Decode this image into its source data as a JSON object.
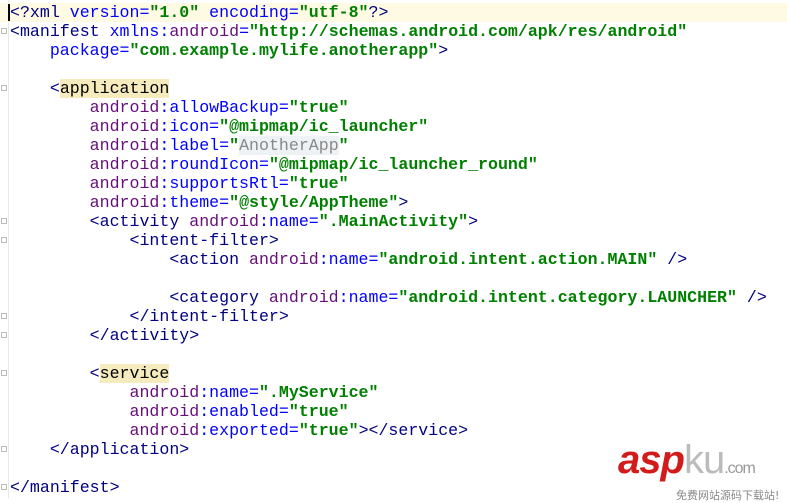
{
  "editor": {
    "current_line": 0,
    "lines": [
      [
        [
          "p",
          "<?xml "
        ],
        [
          "a",
          "version="
        ],
        [
          "v",
          "\"1.0\""
        ],
        [
          "a",
          " encoding="
        ],
        [
          "v",
          "\"utf-8\""
        ],
        [
          "p",
          "?>"
        ]
      ],
      [
        [
          "p",
          "<manifest "
        ],
        [
          "a",
          "xmlns:"
        ],
        [
          "n",
          "android"
        ],
        [
          "a",
          "="
        ],
        [
          "v",
          "\"http://schemas.android.com/apk/res/android\""
        ]
      ],
      [
        [
          "s",
          "    "
        ],
        [
          "a",
          "package="
        ],
        [
          "v",
          "\"com.example.mylife.anotherapp\""
        ],
        [
          "p",
          ">"
        ]
      ],
      [],
      [
        [
          "s",
          "    "
        ],
        [
          "p",
          "<"
        ],
        [
          "hl",
          "application"
        ]
      ],
      [
        [
          "s",
          "        "
        ],
        [
          "n",
          "android"
        ],
        [
          "a",
          ":allowBackup="
        ],
        [
          "v",
          "\"true\""
        ]
      ],
      [
        [
          "s",
          "        "
        ],
        [
          "n",
          "android"
        ],
        [
          "a",
          ":icon="
        ],
        [
          "v",
          "\"@mipmap/ic_launcher\""
        ]
      ],
      [
        [
          "s",
          "        "
        ],
        [
          "n",
          "android"
        ],
        [
          "a",
          ":label="
        ],
        [
          "v",
          "\""
        ],
        [
          "g",
          "AnotherApp"
        ],
        [
          "v",
          "\""
        ]
      ],
      [
        [
          "s",
          "        "
        ],
        [
          "n",
          "android"
        ],
        [
          "a",
          ":roundIcon="
        ],
        [
          "v",
          "\"@mipmap/ic_launcher_round\""
        ]
      ],
      [
        [
          "s",
          "        "
        ],
        [
          "n",
          "android"
        ],
        [
          "a",
          ":supportsRtl="
        ],
        [
          "v",
          "\"true\""
        ]
      ],
      [
        [
          "s",
          "        "
        ],
        [
          "n",
          "android"
        ],
        [
          "a",
          ":theme="
        ],
        [
          "v",
          "\"@style/AppTheme\""
        ],
        [
          "p",
          ">"
        ]
      ],
      [
        [
          "s",
          "        "
        ],
        [
          "p",
          "<activity "
        ],
        [
          "n",
          "android"
        ],
        [
          "a",
          ":name="
        ],
        [
          "v",
          "\".MainActivity\""
        ],
        [
          "p",
          ">"
        ]
      ],
      [
        [
          "s",
          "            "
        ],
        [
          "p",
          "<intent-filter>"
        ]
      ],
      [
        [
          "s",
          "                "
        ],
        [
          "p",
          "<action "
        ],
        [
          "n",
          "android"
        ],
        [
          "a",
          ":name="
        ],
        [
          "v",
          "\"android.intent.action.MAIN\""
        ],
        [
          "p",
          " />"
        ]
      ],
      [],
      [
        [
          "s",
          "                "
        ],
        [
          "p",
          "<category "
        ],
        [
          "n",
          "android"
        ],
        [
          "a",
          ":name="
        ],
        [
          "v",
          "\"android.intent.category.LAUNCHER\""
        ],
        [
          "p",
          " />"
        ]
      ],
      [
        [
          "s",
          "            "
        ],
        [
          "p",
          "</intent-filter>"
        ]
      ],
      [
        [
          "s",
          "        "
        ],
        [
          "p",
          "</activity>"
        ]
      ],
      [],
      [
        [
          "s",
          "        "
        ],
        [
          "p",
          "<"
        ],
        [
          "hl",
          "service"
        ]
      ],
      [
        [
          "s",
          "            "
        ],
        [
          "n",
          "android"
        ],
        [
          "a",
          ":name="
        ],
        [
          "v",
          "\".MyService\""
        ]
      ],
      [
        [
          "s",
          "            "
        ],
        [
          "n",
          "android"
        ],
        [
          "a",
          ":enabled="
        ],
        [
          "v",
          "\"true\""
        ]
      ],
      [
        [
          "s",
          "            "
        ],
        [
          "n",
          "android"
        ],
        [
          "a",
          ":exported="
        ],
        [
          "v",
          "\"true\""
        ],
        [
          "p",
          "></service>"
        ]
      ],
      [
        [
          "s",
          "    "
        ],
        [
          "p",
          "</application>"
        ]
      ],
      [],
      [
        [
          "p",
          "</manifest>"
        ]
      ]
    ]
  },
  "watermark": {
    "brand_red": "asp",
    "brand_gray": "ku",
    "domain": ".com",
    "slogan": "免费网站源码下载站!"
  }
}
